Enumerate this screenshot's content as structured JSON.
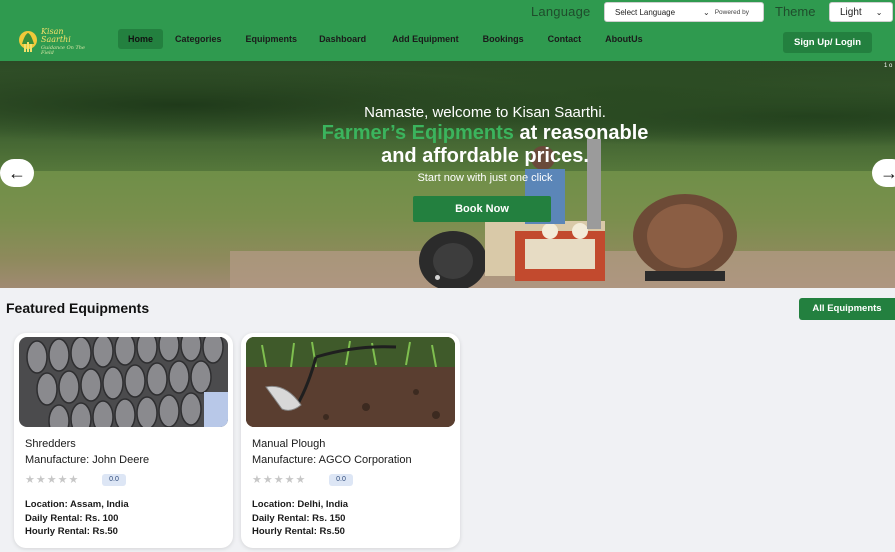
{
  "brand": {
    "name": "Kisan Saarthi",
    "tagline": "Guidance On The Field",
    "colors": {
      "primary": "#2f9a4f",
      "dark": "#23803f",
      "accent": "#3bb45d"
    }
  },
  "header": {
    "language_label": "Language",
    "language_select": {
      "value": "Select Language",
      "powered_by": "Powered by"
    },
    "theme_label": "Theme",
    "theme_select": {
      "value": "Light"
    },
    "nav": [
      {
        "label": "Home",
        "active": true
      },
      {
        "label": "Categories"
      },
      {
        "label": "Equipments"
      },
      {
        "label": "Dashboard"
      },
      {
        "label": "Add Equipment"
      },
      {
        "label": "Bookings"
      },
      {
        "label": "Contact"
      },
      {
        "label": "AboutUs"
      }
    ],
    "signup_label": "Sign Up/ Login"
  },
  "hero": {
    "greeting": "Namaste, welcome to Kisan Saarthi.",
    "headline_green": "Farmer’s Eqipments",
    "headline_rest1": " at reasonable",
    "headline_line2": "and affordable prices.",
    "subtext": "Start now with just one click",
    "cta": "Book Now",
    "pager": "1 o",
    "prev_icon": "arrow-left-icon",
    "next_icon": "arrow-right-icon"
  },
  "featured": {
    "title": "Featured Equipments",
    "all_button": "All Equipments",
    "cards": [
      {
        "name": "Shredders",
        "manufacturer": "Manufacture: John Deere",
        "rating": "0.0",
        "stars": "★★★★★",
        "location": "Location: Assam, India",
        "daily": "Daily Rental: Rs. 100",
        "hourly": "Hourly Rental: Rs.50"
      },
      {
        "name": "Manual Plough",
        "manufacturer": "Manufacture: AGCO Corporation",
        "rating": "0.0",
        "stars": "★★★★★",
        "location": "Location: Delhi, India",
        "daily": "Daily Rental: Rs. 150",
        "hourly": "Hourly Rental: Rs.50"
      }
    ]
  }
}
